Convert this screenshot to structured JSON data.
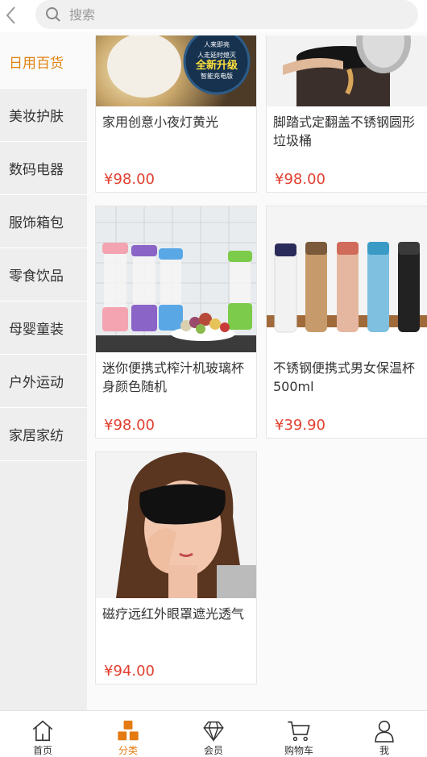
{
  "search": {
    "placeholder": "搜索"
  },
  "categories": [
    {
      "label": "日用百货",
      "active": true
    },
    {
      "label": "美妆护肤"
    },
    {
      "label": "数码电器"
    },
    {
      "label": "服饰箱包"
    },
    {
      "label": "零食饮品"
    },
    {
      "label": "母婴童装"
    },
    {
      "label": "户外运动"
    },
    {
      "label": "家居家纺"
    }
  ],
  "products": [
    {
      "name": "家用创意小夜灯黄光",
      "price": "¥98.00",
      "image": "night-lamp",
      "badge": [
        "人来即亮",
        "人走延时熄灭",
        "全新升级",
        "智能充电版"
      ]
    },
    {
      "name": "脚踏式定翻盖不锈钢圆形垃圾桶",
      "price": "¥98.00",
      "image": "trash-can"
    },
    {
      "name": "迷你便携式榨汁机玻璃杯身颜色随机",
      "price": "¥98.00",
      "image": "juicers"
    },
    {
      "name": "不锈钢便携式男女保温杯500ml",
      "price": "¥39.90",
      "image": "thermos"
    },
    {
      "name": "磁疗远红外眼罩遮光透气",
      "price": "¥94.00",
      "image": "eye-mask"
    }
  ],
  "tabs": [
    {
      "label": "首页",
      "icon": "home-icon"
    },
    {
      "label": "分类",
      "icon": "category-icon",
      "active": true
    },
    {
      "label": "会员",
      "icon": "diamond-icon"
    },
    {
      "label": "购物车",
      "icon": "cart-icon"
    },
    {
      "label": "我",
      "icon": "user-icon"
    }
  ],
  "colors": {
    "accent": "#e47a12",
    "price": "#e24030",
    "sidebar": "#eeeeee"
  }
}
